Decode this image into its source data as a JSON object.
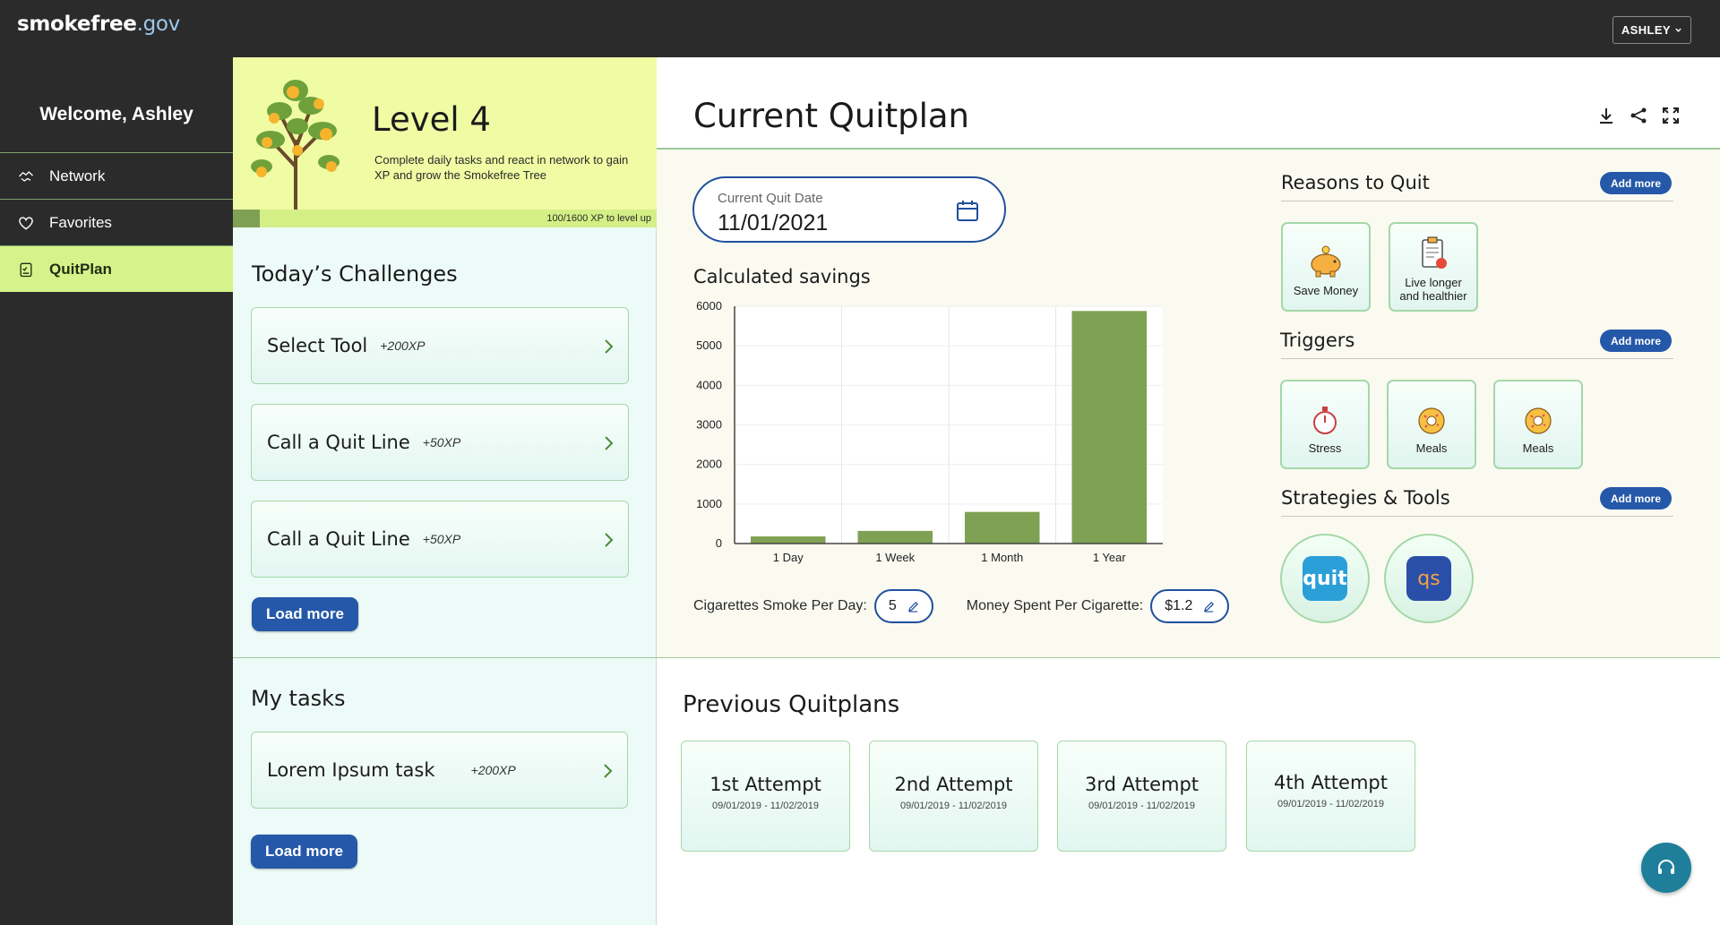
{
  "app": {
    "logo_main": "smokefree",
    "logo_suffix": ".gov",
    "user_menu_label": "ASHLEY"
  },
  "sidebar": {
    "welcome": "Welcome, Ashley",
    "items": [
      {
        "label": "Network",
        "icon": "network-icon"
      },
      {
        "label": "Favorites",
        "icon": "heart-icon"
      },
      {
        "label": "QuitPlan",
        "icon": "clipboard-icon",
        "active": true
      }
    ]
  },
  "level": {
    "title": "Level 4",
    "description": "Complete daily tasks and react in network to gain XP and grow the Smokefree Tree",
    "xp_text": "100/1600 XP to level up",
    "xp_current": 100,
    "xp_total": 1600
  },
  "challenges": {
    "title": "Today’s Challenges",
    "items": [
      {
        "name": "Select Tool",
        "xp": "+200XP"
      },
      {
        "name": "Call a Quit Line",
        "xp": "+50XP"
      },
      {
        "name": "Call a Quit Line",
        "xp": "+50XP"
      }
    ],
    "load_more": "Load more"
  },
  "tasks": {
    "title": "My tasks",
    "items": [
      {
        "name": "Lorem Ipsum task",
        "xp": "+200XP"
      }
    ],
    "load_more": "Load more"
  },
  "quitplan": {
    "title": "Current Quitplan",
    "date_label": "Current Quit Date",
    "date_value": "11/01/2021",
    "savings_title": "Calculated savings",
    "cigs_label": "Cigarettes Smoke Per Day:",
    "cigs_value": "5",
    "money_label": "Money Spent Per Cigarette:",
    "money_value": "$1.2"
  },
  "chart_data": {
    "type": "bar",
    "categories": [
      "1 Day",
      "1 Week",
      "1 Month",
      "1 Year"
    ],
    "values": [
      180,
      320,
      800,
      5880
    ],
    "ylim": [
      0,
      6000
    ],
    "yticks": [
      0,
      1000,
      2000,
      3000,
      4000,
      5000,
      6000
    ],
    "color": "#7fa153",
    "grid": true
  },
  "reasons": {
    "title": "Reasons to Quit",
    "add_more": "Add more",
    "items": [
      {
        "label": "Save Money",
        "icon": "piggy-bank-icon"
      },
      {
        "label": "Live longer and healthier",
        "icon": "health-clipboard-icon"
      }
    ]
  },
  "triggers": {
    "title": "Triggers",
    "add_more": "Add more",
    "items": [
      {
        "label": "Stress",
        "icon": "stopwatch-icon"
      },
      {
        "label": "Meals",
        "icon": "donut-icon"
      },
      {
        "label": "Meals",
        "icon": "donut-icon"
      }
    ]
  },
  "strategies": {
    "title": "Strategies & Tools",
    "add_more": "Add more",
    "items": [
      {
        "label": "quit",
        "icon": "quitguide-app-icon"
      },
      {
        "label": "qs",
        "icon": "quitstart-app-icon"
      }
    ]
  },
  "previous": {
    "title": "Previous Quitplans",
    "items": [
      {
        "name": "1st Attempt",
        "dates": "09/01/2019 - 11/02/2019"
      },
      {
        "name": "2nd Attempt",
        "dates": "09/01/2019 - 11/02/2019"
      },
      {
        "name": "3rd Attempt",
        "dates": "09/01/2019 - 11/02/2019"
      },
      {
        "name": "4th Attempt",
        "dates": "09/01/2019 - 11/02/2019"
      }
    ]
  }
}
